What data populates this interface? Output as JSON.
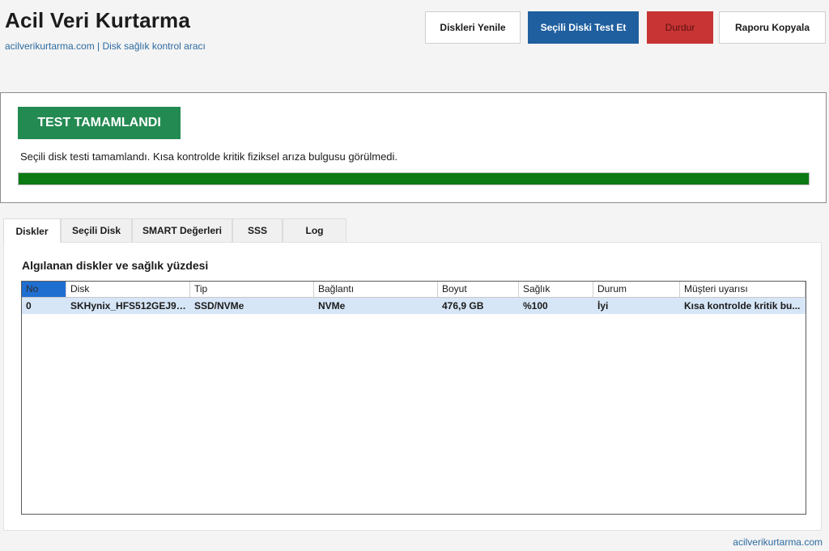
{
  "header": {
    "title": "Acil Veri Kurtarma",
    "subtitle": "acilverikurtarma.com | Disk sağlık kontrol aracı"
  },
  "toolbar": {
    "refresh_label": "Diskleri Yenile",
    "test_label": "Seçili Diski Test Et",
    "stop_label": "Durdur",
    "copy_label": "Raporu Kopyala"
  },
  "status": {
    "badge": "TEST TAMAMLANDI",
    "message": "Seçili disk testi tamamlandı. Kısa kontrolde kritik fiziksel arıza bulgusu görülmedi.",
    "progress_percent": 100
  },
  "tabs": [
    {
      "label": "Diskler",
      "active": true
    },
    {
      "label": "Seçili Disk",
      "active": false
    },
    {
      "label": "SMART Değerleri",
      "active": false
    },
    {
      "label": "SSS",
      "active": false
    },
    {
      "label": "Log",
      "active": false
    }
  ],
  "disks_tab": {
    "section_title": "Algılanan diskler ve sağlık yüzdesi",
    "columns": [
      "No",
      "Disk",
      "Tip",
      "Bağlantı",
      "Boyut",
      "Sağlık",
      "Durum",
      "Müşteri uyarısı"
    ],
    "rows": [
      [
        "0",
        "SKHynix_HFS512GEJ9X...",
        "SSD/NVMe",
        "NVMe",
        "476,9 GB",
        "%100",
        "İyi",
        "Kısa kontrolde kritik bu..."
      ]
    ]
  },
  "footer": {
    "link": "acilverikurtarma.com"
  },
  "colors": {
    "primary_button": "#1f5f9f",
    "stop_button": "#c83434",
    "status_badge": "#238a52",
    "progress_fill": "#0b7a12",
    "selected_row": "#d6e6f7",
    "link": "#2d6aa0"
  }
}
